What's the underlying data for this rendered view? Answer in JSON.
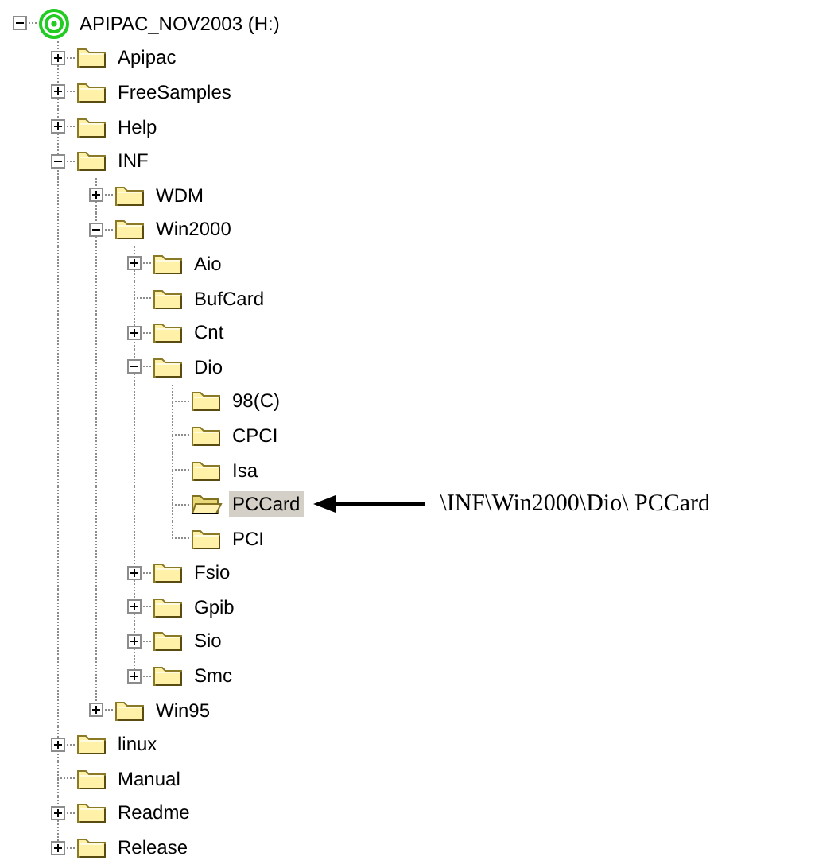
{
  "tree": [
    {
      "label": "APIPAC_NOV2003 (H:)",
      "kind": "drive",
      "has_children": true,
      "expanded": true,
      "selected": false,
      "children": [
        {
          "label": "Apipac",
          "kind": "folder",
          "has_children": true,
          "expanded": false,
          "selected": false
        },
        {
          "label": "FreeSamples",
          "kind": "folder",
          "has_children": true,
          "expanded": false,
          "selected": false
        },
        {
          "label": "Help",
          "kind": "folder",
          "has_children": true,
          "expanded": false,
          "selected": false
        },
        {
          "label": "INF",
          "kind": "folder",
          "has_children": true,
          "expanded": true,
          "selected": false,
          "children": [
            {
              "label": "WDM",
              "kind": "folder",
              "has_children": true,
              "expanded": false,
              "selected": false
            },
            {
              "label": "Win2000",
              "kind": "folder",
              "has_children": true,
              "expanded": true,
              "selected": false,
              "children": [
                {
                  "label": "Aio",
                  "kind": "folder",
                  "has_children": true,
                  "expanded": false,
                  "selected": false
                },
                {
                  "label": "BufCard",
                  "kind": "folder",
                  "selected": false
                },
                {
                  "label": "Cnt",
                  "kind": "folder",
                  "has_children": true,
                  "expanded": false,
                  "selected": false
                },
                {
                  "label": "Dio",
                  "kind": "folder",
                  "has_children": true,
                  "expanded": true,
                  "selected": false,
                  "children": [
                    {
                      "label": "98(C)",
                      "kind": "folder",
                      "selected": false
                    },
                    {
                      "label": "CPCI",
                      "kind": "folder",
                      "selected": false
                    },
                    {
                      "label": "Isa",
                      "kind": "folder",
                      "selected": false
                    },
                    {
                      "label": "PCCard",
                      "kind": "folder",
                      "selected": true,
                      "callout": "\\INF\\Win2000\\Dio\\ PCCard"
                    },
                    {
                      "label": "PCI",
                      "kind": "folder",
                      "selected": false
                    }
                  ]
                },
                {
                  "label": "Fsio",
                  "kind": "folder",
                  "has_children": true,
                  "expanded": false,
                  "selected": false
                },
                {
                  "label": "Gpib",
                  "kind": "folder",
                  "has_children": true,
                  "expanded": false,
                  "selected": false
                },
                {
                  "label": "Sio",
                  "kind": "folder",
                  "has_children": true,
                  "expanded": false,
                  "selected": false
                },
                {
                  "label": "Smc",
                  "kind": "folder",
                  "has_children": true,
                  "expanded": false,
                  "selected": false
                }
              ]
            },
            {
              "label": "Win95",
              "kind": "folder",
              "has_children": true,
              "expanded": false,
              "selected": false
            }
          ]
        },
        {
          "label": "linux",
          "kind": "folder",
          "has_children": true,
          "expanded": false,
          "selected": false
        },
        {
          "label": "Manual",
          "kind": "folder",
          "selected": false
        },
        {
          "label": "Readme",
          "kind": "folder",
          "has_children": true,
          "expanded": false,
          "selected": false
        },
        {
          "label": "Release",
          "kind": "folder",
          "has_children": true,
          "expanded": false,
          "selected": false
        }
      ]
    }
  ]
}
